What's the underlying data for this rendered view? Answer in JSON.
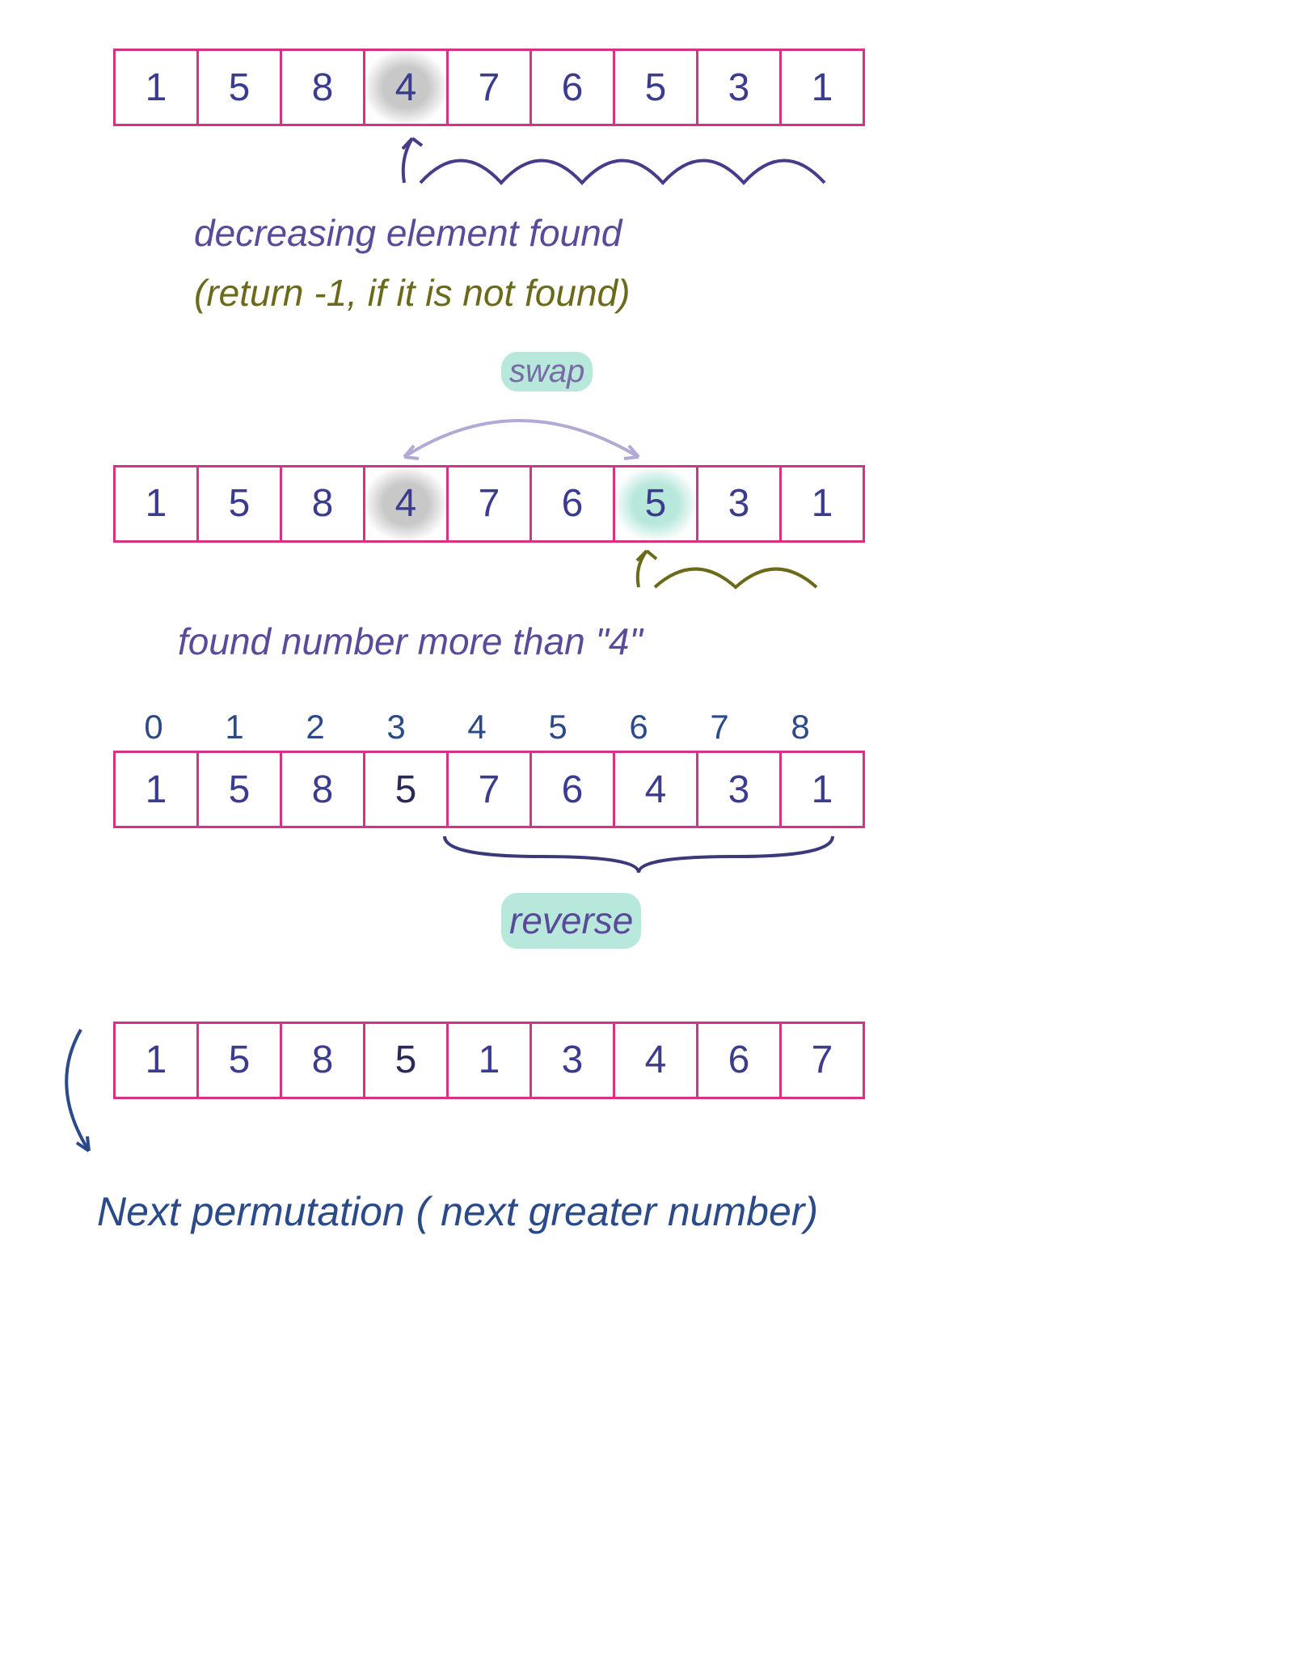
{
  "step1": {
    "array": [
      "1",
      "5",
      "8",
      "4",
      "7",
      "6",
      "5",
      "3",
      "1"
    ],
    "highlight_grey_index": 3,
    "note_line1": "decreasing element found",
    "note_line2": "(return -1, if it is not found)"
  },
  "step2": {
    "swap_label": "swap",
    "array": [
      "1",
      "5",
      "8",
      "4",
      "7",
      "6",
      "5",
      "3",
      "1"
    ],
    "highlight_grey_index": 3,
    "highlight_teal_index": 6,
    "note": "found number more than \"4\""
  },
  "step3": {
    "indices": [
      "0",
      "1",
      "2",
      "3",
      "4",
      "5",
      "6",
      "7",
      "8"
    ],
    "array": [
      "1",
      "5",
      "8",
      "5",
      "7",
      "6",
      "4",
      "3",
      "1"
    ],
    "dark_index": 3,
    "reverse_label": "reverse",
    "reverse_start": 4,
    "reverse_end": 8
  },
  "step4": {
    "array": [
      "1",
      "5",
      "8",
      "5",
      "1",
      "3",
      "4",
      "6",
      "7"
    ],
    "dark_index": 3,
    "note": "Next permutation ( next greater number)"
  }
}
